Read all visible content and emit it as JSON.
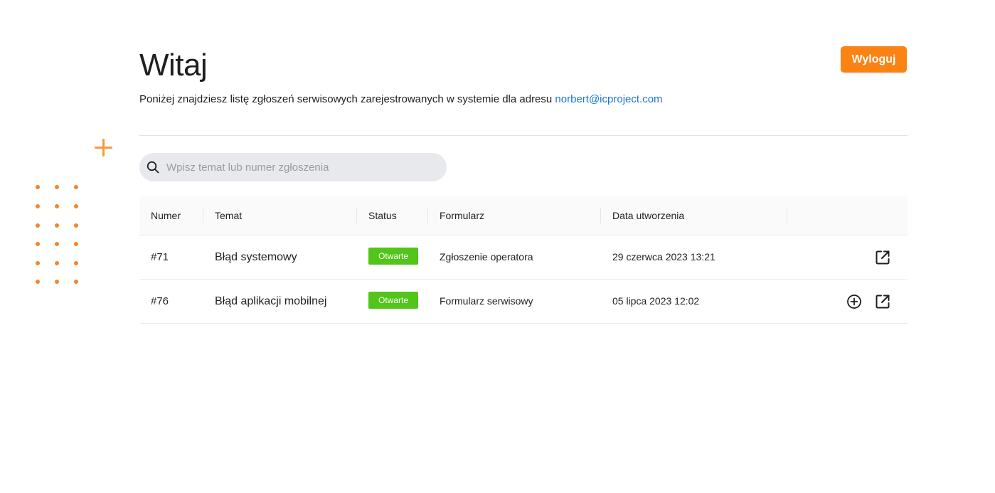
{
  "header": {
    "title": "Witaj",
    "logout_label": "Wyloguj",
    "intro_text": "Poniżej znajdziesz listę zgłoszeń serwisowych zarejestrowanych w systemie dla adresu ",
    "email": "norbert@icproject.com"
  },
  "search": {
    "placeholder": "Wpisz temat lub numer zgłoszenia",
    "value": "",
    "icon": "search-icon"
  },
  "table": {
    "columns": {
      "number": "Numer",
      "topic": "Temat",
      "status": "Status",
      "form": "Formularz",
      "created": "Data utworzenia"
    },
    "rows": [
      {
        "number": "#71",
        "topic": "Błąd systemowy",
        "status": "Otwarte",
        "form": "Zgłoszenie operatora",
        "created": "29 czerwca 2023 13:21",
        "actions": [
          "open-external-icon"
        ]
      },
      {
        "number": "#76",
        "topic": "Błąd aplikacji mobilnej",
        "status": "Otwarte",
        "form": "Formularz serwisowy",
        "created": "05 lipca 2023 12:02",
        "actions": [
          "add-circle-icon",
          "open-external-icon"
        ]
      }
    ]
  },
  "colors": {
    "accent": "#fb8314",
    "link": "#1a73d9",
    "status_open": "#52c41a",
    "decoration": "#f2862a"
  }
}
